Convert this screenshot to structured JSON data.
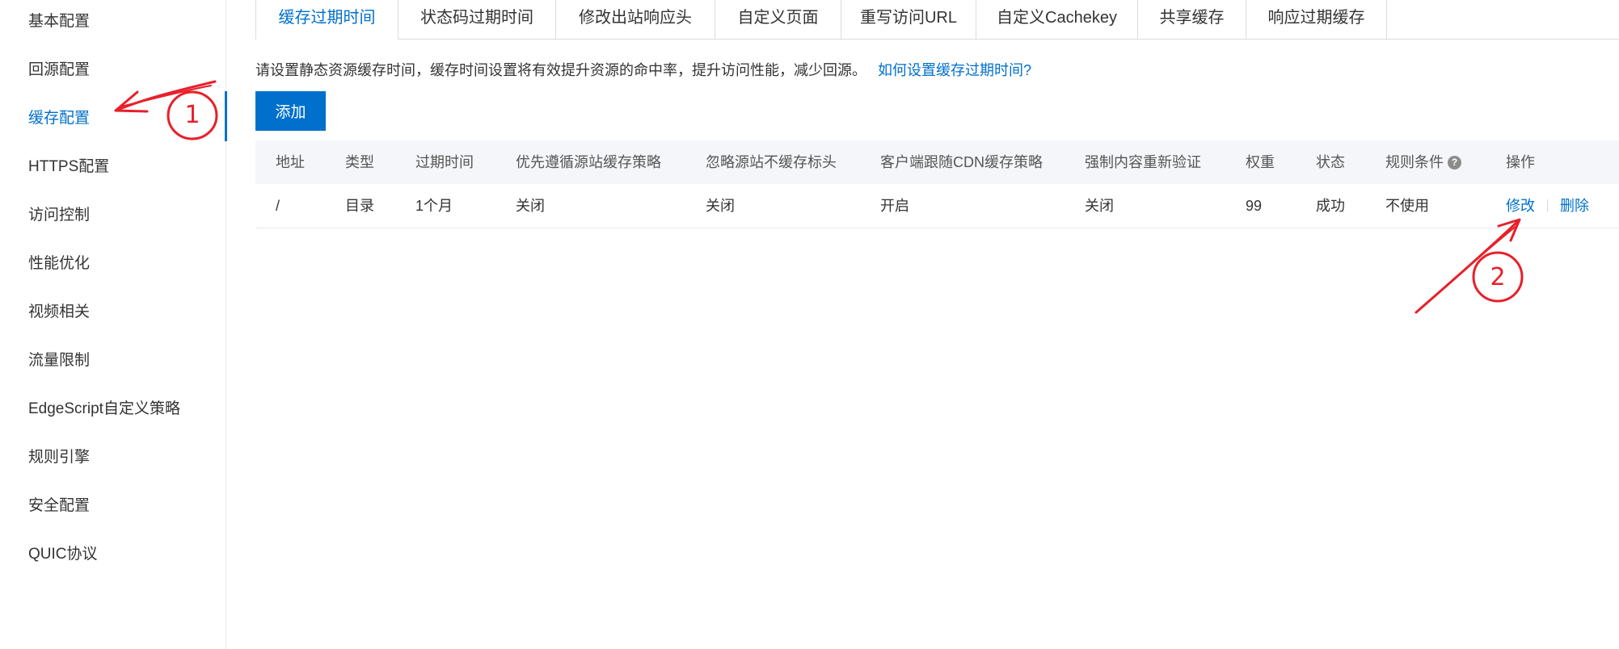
{
  "sidebar": {
    "items": [
      {
        "label": "基本配置"
      },
      {
        "label": "回源配置"
      },
      {
        "label": "缓存配置"
      },
      {
        "label": "HTTPS配置"
      },
      {
        "label": "访问控制"
      },
      {
        "label": "性能优化"
      },
      {
        "label": "视频相关"
      },
      {
        "label": "流量限制"
      },
      {
        "label": "EdgeScript自定义策略"
      },
      {
        "label": "规则引擎"
      },
      {
        "label": "安全配置"
      },
      {
        "label": "QUIC协议"
      }
    ],
    "active_index": 2
  },
  "tabs": [
    {
      "label": "缓存过期时间"
    },
    {
      "label": "状态码过期时间"
    },
    {
      "label": "修改出站响应头"
    },
    {
      "label": "自定义页面"
    },
    {
      "label": "重写访问URL"
    },
    {
      "label": "自定义Cachekey"
    },
    {
      "label": "共享缓存"
    },
    {
      "label": "响应过期缓存"
    }
  ],
  "main": {
    "description": "请设置静态资源缓存时间，缓存时间设置将有效提升资源的命中率，提升访问性能，减少回源。",
    "help_link": "如何设置缓存过期时间?",
    "add_button": "添加"
  },
  "table": {
    "headers": [
      "地址",
      "类型",
      "过期时间",
      "优先遵循源站缓存策略",
      "忽略源站不缓存标头",
      "客户端跟随CDN缓存策略",
      "强制内容重新验证",
      "权重",
      "状态",
      "规则条件",
      "操作"
    ],
    "help_icon": "?",
    "rows": [
      {
        "cells": [
          "/",
          "目录",
          "1个月",
          "关闭",
          "关闭",
          "开启",
          "关闭",
          "99",
          "成功",
          "不使用"
        ],
        "actions": {
          "edit": "修改",
          "delete": "删除"
        }
      }
    ]
  },
  "annotations": {
    "marker_1": "1",
    "marker_2": "2",
    "color": "#e8202a"
  },
  "colors": {
    "accent": "#0070cc",
    "header_bg": "#f5f6fa"
  }
}
